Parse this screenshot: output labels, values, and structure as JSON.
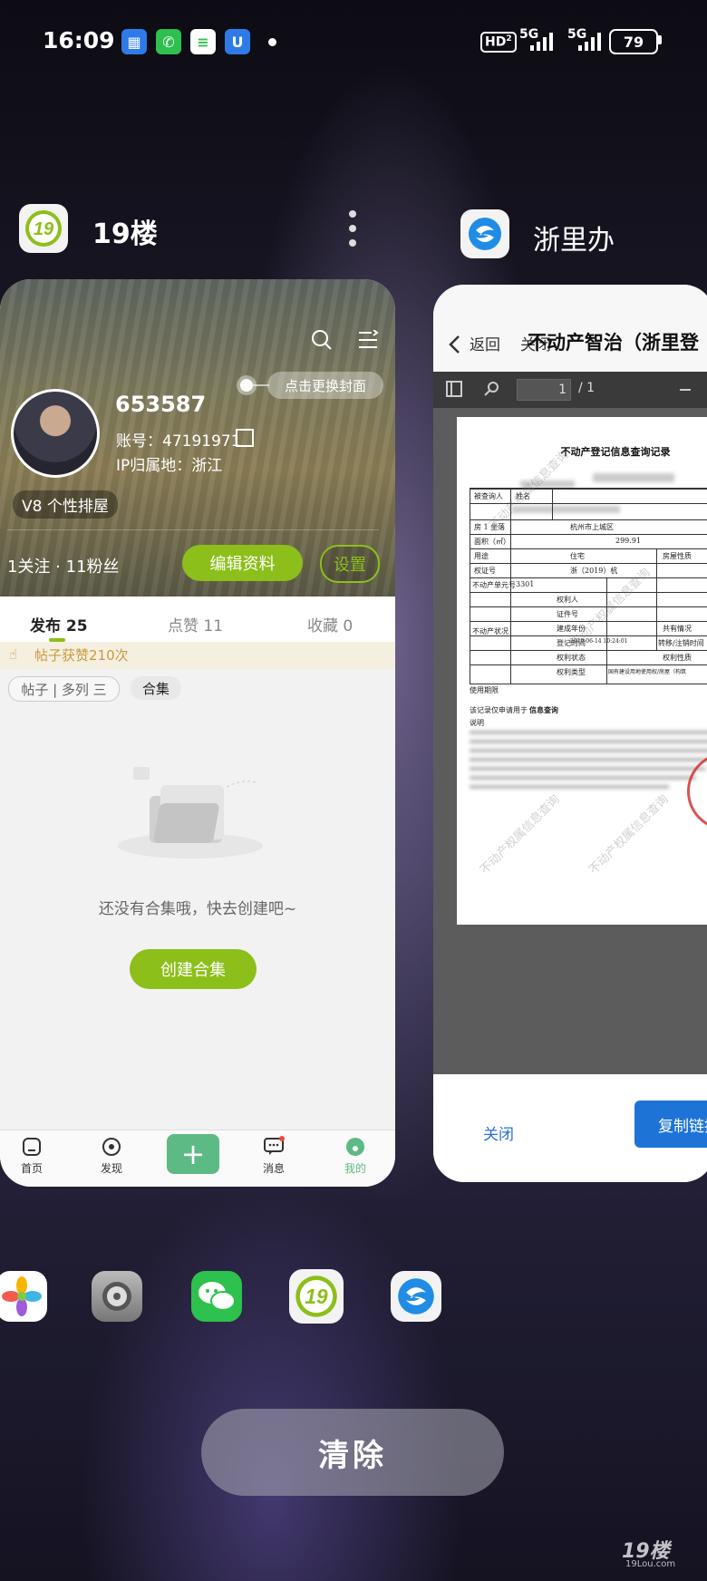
{
  "status_bar": {
    "time": "16:09",
    "hd": "HD",
    "hd_sub": "2",
    "net1": "5G",
    "net2": "5G",
    "battery": "79",
    "notification_icons": [
      "app-icon",
      "phone-icon",
      "message-icon",
      "shield-icon"
    ]
  },
  "recents": {
    "left_app": {
      "name": "19楼",
      "profile": {
        "cover_button": "点击更换封面",
        "username": "653587",
        "account": "账号：47191971",
        "ip": "IP归属地：浙江",
        "level_badge": "V8 个性排屋",
        "follow_stats": "1关注 · 11粉丝",
        "edit_button": "编辑资料",
        "settings_button": "设置"
      },
      "tabs": [
        {
          "label": "发布 25"
        },
        {
          "label": "点赞 11"
        },
        {
          "label": "收藏 0"
        }
      ],
      "likes_banner": "帖子获赞210次",
      "filter_chip": "帖子 | 多列 三",
      "filter_chip_selected": "合集",
      "empty_text": "还没有合集哦，快去创建吧~",
      "create_button": "创建合集",
      "bottom_nav": [
        {
          "label": "首页"
        },
        {
          "label": "发现"
        },
        {
          "label": "消息"
        },
        {
          "label": "我的"
        }
      ],
      "accent_color": "#8cbf1a"
    },
    "right_app": {
      "name": "浙里办",
      "back_label": "返回",
      "close_label": "关闭",
      "page_title": "不动产智治（浙里登",
      "pdf": {
        "page_input": "1",
        "page_total": "/ 1",
        "doc_title": "不动产登记信息查询记录",
        "cells": {
          "checked_person": "被查询人",
          "name": "姓名",
          "house": "房 1 坐落",
          "location": "杭州市上城区",
          "area_label": "面积（㎡）",
          "area_value": "299.91",
          "use_label": "用途",
          "use_value": "住宅",
          "nature_label": "房屋性质",
          "cert_label": "权证号",
          "cert_value": "浙（2019）杭",
          "unit_label": "不动产单元号",
          "unit_value": "3301",
          "status_label": "不动产状况",
          "owner_label": "权利人",
          "id_label": "证件号",
          "year_label": "建成年份",
          "share_label": "共有情况",
          "reg_time_label": "登记时间",
          "reg_time_value": "2019-06-14 10:24:01",
          "transfer_label": "转移/注销时间",
          "right_status_label": "权利状态",
          "right_nature_label": "权利性质",
          "right_type_label": "权利类型",
          "right_type_value": "国有建设用地使用权/房屋（构筑",
          "term_label": "使用期限",
          "purpose_label": "该记录仅申请用于",
          "purpose_value": "信息查询",
          "notes_label": "说明"
        },
        "watermark": "不动产权属信息查询"
      },
      "close_button": "关闭",
      "copy_button": "复制链接"
    }
  },
  "dock": [
    {
      "icon": "photos-icon"
    },
    {
      "icon": "settings-icon"
    },
    {
      "icon": "wechat-icon"
    },
    {
      "icon": "19lou-icon"
    },
    {
      "icon": "zheliban-icon"
    }
  ],
  "clear_button": "清除",
  "watermark": {
    "logo": "19楼",
    "site": "19Lou.com"
  }
}
